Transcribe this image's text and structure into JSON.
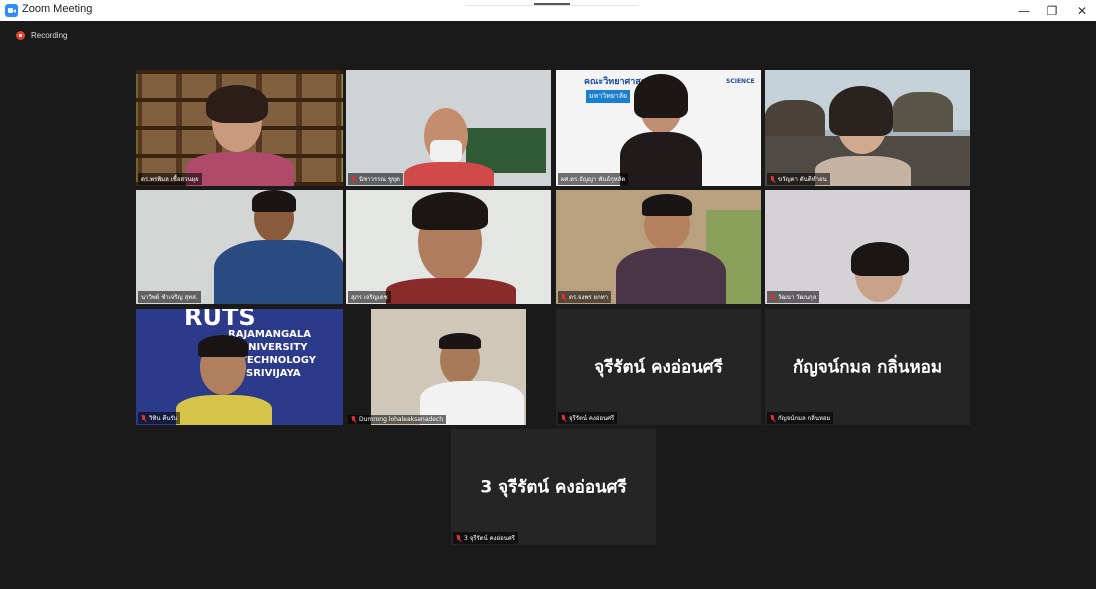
{
  "window": {
    "title": "Zoom Meeting"
  },
  "window_controls": {
    "minimize": "—",
    "restore": "❐",
    "close": "✕"
  },
  "recording": {
    "label": "Recording"
  },
  "participants": [
    {
      "name": "ดร.พรพิมล เชื้อสวนผุย",
      "video": true,
      "active": true,
      "muted": false
    },
    {
      "name": "นิชาวรรณ ชูขุด",
      "video": true,
      "muted": true
    },
    {
      "name": "ผศ.ดร.ธัญญา พันธ์กุหลัด",
      "video": true,
      "muted": false
    },
    {
      "name": "ขวัญตา ดันดีทำอน",
      "video": true,
      "muted": true
    },
    {
      "name": "นาวิพย์ ชำเจริญ สุทส.",
      "video": true,
      "muted": false
    },
    {
      "name": "สุภร เจริญเดช",
      "video": true,
      "muted": false
    },
    {
      "name": "ดร.จงพร ยกทา",
      "video": true,
      "muted": true
    },
    {
      "name": "วัฒนา วัฒนกุล",
      "video": true,
      "muted": true
    },
    {
      "name": "วิทิน คีนรับ",
      "video": true,
      "muted": true
    },
    {
      "name": "Dumrong lohaleaksanadech",
      "video": true,
      "muted": true
    },
    {
      "name": "จุรีรัตน์ คงอ่อนศรี",
      "display": "จุรีรัตน์ คงอ่อนศรี",
      "video": false,
      "muted": true
    },
    {
      "name": "กัญจน์กมล กลิ่นหอม",
      "display": "กัญจน์กมล กลิ่นหอม",
      "video": false,
      "muted": true
    },
    {
      "name": "3 จุรีรัตน์ คงอ่อนศรี",
      "display": "3 จุรีรัตน์ คงอ่อนศรี",
      "video": false,
      "muted": true
    }
  ],
  "tile1_sign": {
    "title": "คณะวิทยาศาสตร์",
    "sub": "มหาวิทยาลัย",
    "logo": "SCIENCE"
  },
  "tile8_banner": {
    "big": "RUTS",
    "line1": "RAJAMANGALA",
    "line2": "UNIVERSITY",
    "line3": "TECHNOLOGY",
    "line4": "SRIVIJAYA"
  },
  "colors": {
    "active_border": "#c7e04a",
    "muted_red": "#e03030",
    "record_red": "#e0412f",
    "tile_bg": "#252525"
  }
}
